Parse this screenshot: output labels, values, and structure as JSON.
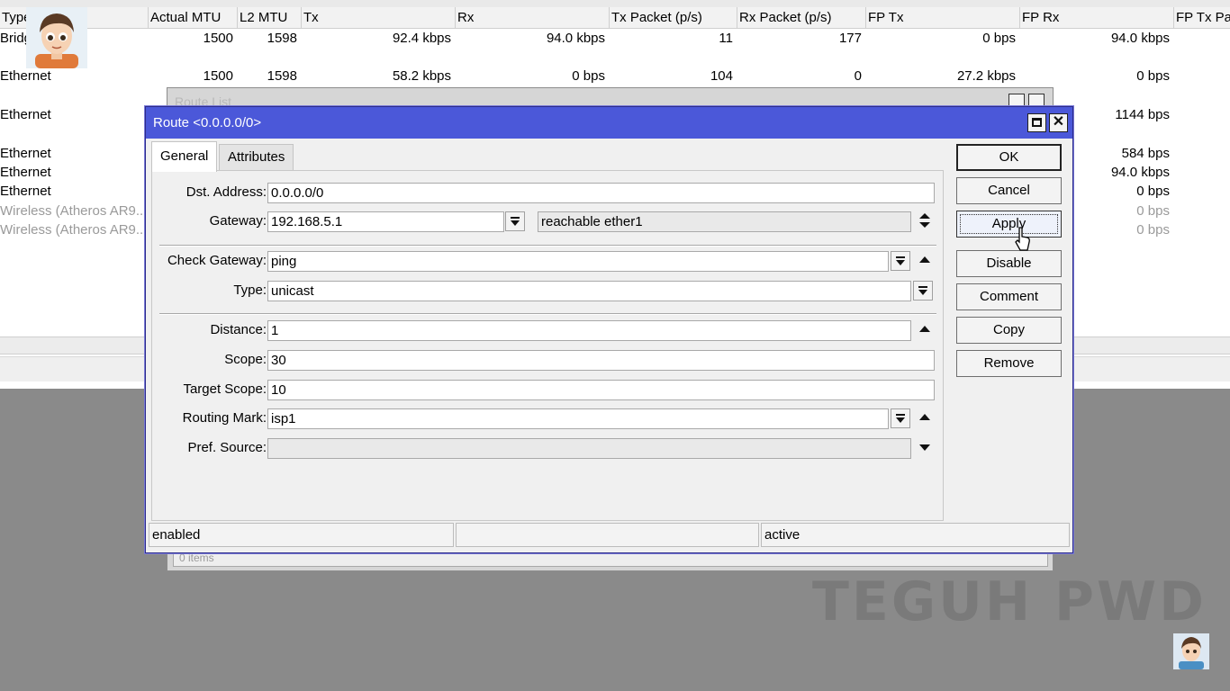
{
  "background_table": {
    "headers": [
      "Type",
      "Actual MTU",
      "L2 MTU",
      "Tx",
      "Rx",
      "Tx Packet (p/s)",
      "Rx Packet (p/s)",
      "FP Tx",
      "FP Rx",
      "FP Tx Pa"
    ],
    "rows": [
      {
        "type": "Bridg",
        "actual_mtu": "1500",
        "l2_mtu": "1598",
        "tx": "92.4 kbps",
        "rx": "94.0 kbps",
        "tx_packet": "11",
        "rx_packet": "177",
        "fp_tx": "0 bps",
        "fp_rx": "94.0 kbps"
      },
      {
        "type": "Ethernet",
        "actual_mtu": "1500",
        "l2_mtu": "1598",
        "tx": "58.2 kbps",
        "rx": "0 bps",
        "tx_packet": "104",
        "rx_packet": "0",
        "fp_tx": "27.2 kbps",
        "fp_rx": "0 bps"
      },
      {
        "type": "Ethernet",
        "fp_rx": "1144 bps"
      },
      {
        "type": "Ethernet",
        "fp_rx": "584 bps"
      },
      {
        "type": "Ethernet",
        "fp_rx": "94.0 kbps"
      },
      {
        "type": "Ethernet",
        "fp_rx": "0 bps"
      },
      {
        "type": "Wireless (Atheros AR9...",
        "fp_rx": "0 bps"
      },
      {
        "type": "Wireless (Atheros AR9...",
        "fp_rx": "0 bps"
      }
    ]
  },
  "route_list": {
    "title": "Route List",
    "footer": "0 items"
  },
  "dialog": {
    "title": "Route <0.0.0.0/0>",
    "tabs": [
      "General",
      "Attributes"
    ],
    "active_tab": "General",
    "fields": {
      "dst_address": {
        "label": "Dst. Address:",
        "value": "0.0.0.0/0"
      },
      "gateway": {
        "label": "Gateway:",
        "value": "192.168.5.1",
        "status": "reachable ether1"
      },
      "check_gateway": {
        "label": "Check Gateway:",
        "value": "ping"
      },
      "type": {
        "label": "Type:",
        "value": "unicast"
      },
      "distance": {
        "label": "Distance:",
        "value": "1"
      },
      "scope": {
        "label": "Scope:",
        "value": "30"
      },
      "target_scope": {
        "label": "Target Scope:",
        "value": "10"
      },
      "routing_mark": {
        "label": "Routing Mark:",
        "value": "isp1"
      },
      "pref_source": {
        "label": "Pref. Source:",
        "value": ""
      }
    },
    "buttons": {
      "ok": "OK",
      "cancel": "Cancel",
      "apply": "Apply",
      "disable": "Disable",
      "comment": "Comment",
      "copy": "Copy",
      "remove": "Remove"
    },
    "status": {
      "left": "enabled",
      "middle": "",
      "right": "active"
    }
  },
  "watermark": "TEGUH PWD",
  "icons": {
    "dropdown": "dropdown-icon",
    "up": "arrow-up-icon",
    "down": "arrow-down-icon",
    "updown": "arrow-updown-icon"
  },
  "colors": {
    "titlebar": "#4b58d9",
    "desktop": "#8a8a8a"
  }
}
